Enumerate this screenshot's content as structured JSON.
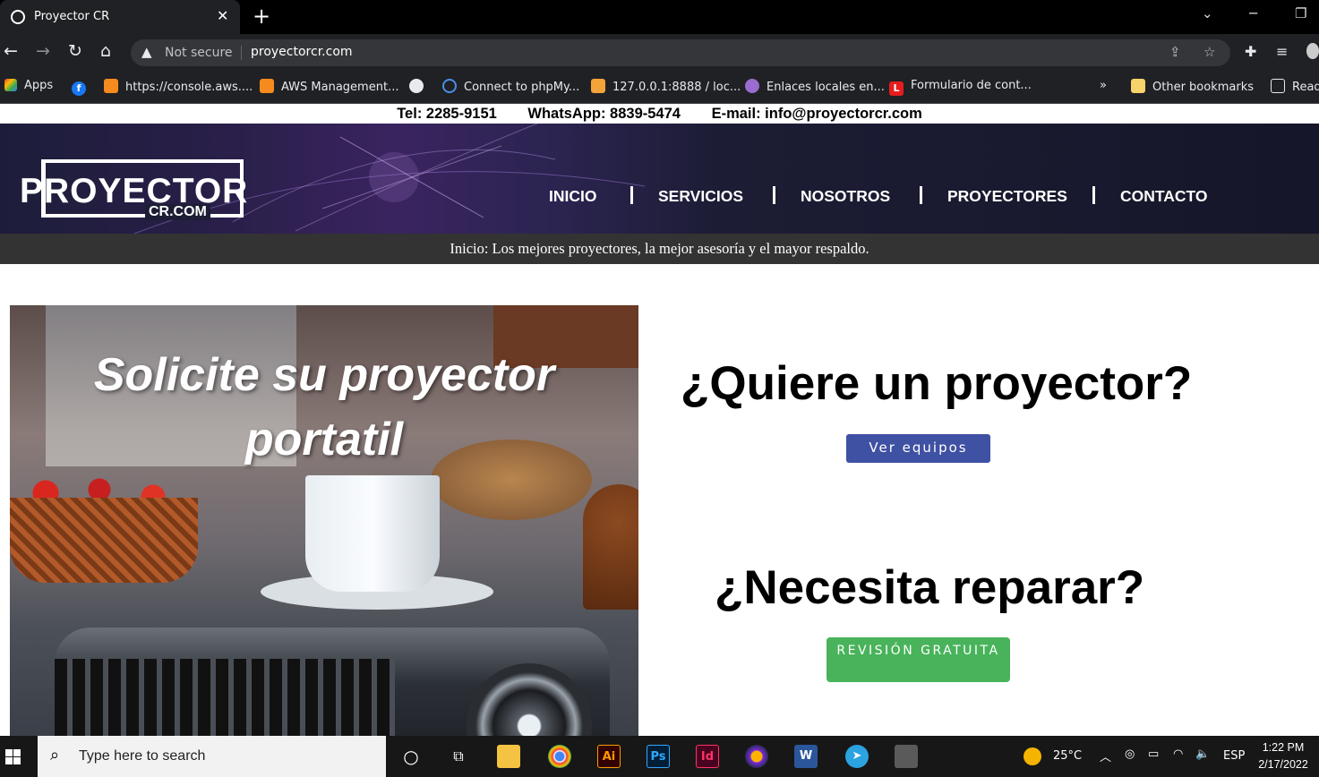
{
  "browser": {
    "tab_title": "Proyector CR",
    "tab_close": "✕",
    "new_tab": "+",
    "security_label": "Not secure",
    "url": "proyectorcr.com",
    "bookmarks": [
      {
        "label": "Apps",
        "icon": "apps-grid-icon"
      },
      {
        "label": "",
        "icon": "facebook-icon"
      },
      {
        "label": "https://console.aws....",
        "icon": "aws-icon"
      },
      {
        "label": "AWS Management...",
        "icon": "aws-icon"
      },
      {
        "label": "",
        "icon": "globe-icon"
      },
      {
        "label": "Connect to phpMy...",
        "icon": "phpmyadmin-icon"
      },
      {
        "label": "127.0.0.1:8888 / loc...",
        "icon": "phpmyadmin-sail-icon"
      },
      {
        "label": "Enlaces locales en...",
        "icon": "globe-purple-icon"
      },
      {
        "label": "Formulario de cont...",
        "icon": "l-red-icon"
      }
    ],
    "bookmarks_overflow": "»",
    "other_bookmarks": "Other bookmarks",
    "reading_list": "Read"
  },
  "site": {
    "contact": {
      "tel": "Tel: 2285-9151",
      "whatsapp": "WhatsApp: 8839-5474",
      "email": "E-mail: info@proyectorcr.com"
    },
    "logo": {
      "word": "PROYECTOR",
      "domain": "CR.COM"
    },
    "nav": [
      "INICIO",
      "SERVICIOS",
      "NOSOTROS",
      "PROYECTORES",
      "CONTACTO"
    ],
    "breadcrumb": "Inicio: Los mejores proyectores, la mejor asesoría y el mayor respaldo.",
    "hero": {
      "line1": "Solicite su proyector",
      "line2": "portatil"
    },
    "question1": "¿Quiere un proyector?",
    "button1": "Ver equipos",
    "question2": "¿Necesita reparar?",
    "button2": "REVISIÓN GRATUITA"
  },
  "taskbar": {
    "search_placeholder": "Type here to search",
    "weather": "25°C",
    "language": "ESP",
    "time": "1:22 PM",
    "date": "2/17/2022",
    "apps": [
      {
        "name": "illustrator",
        "label": "Ai",
        "fg": "#ff9a00",
        "bg": "#330000"
      },
      {
        "name": "photoshop",
        "label": "Ps",
        "fg": "#31a8ff",
        "bg": "#001e36"
      },
      {
        "name": "indesign",
        "label": "Id",
        "fg": "#ff3366",
        "bg": "#49021f"
      },
      {
        "name": "word",
        "label": "W",
        "fg": "#ffffff",
        "bg": "#2b579a"
      }
    ]
  },
  "colors": {
    "button_blue": "#3f51a3",
    "button_green": "#48b35a",
    "subbar": "#333333"
  }
}
